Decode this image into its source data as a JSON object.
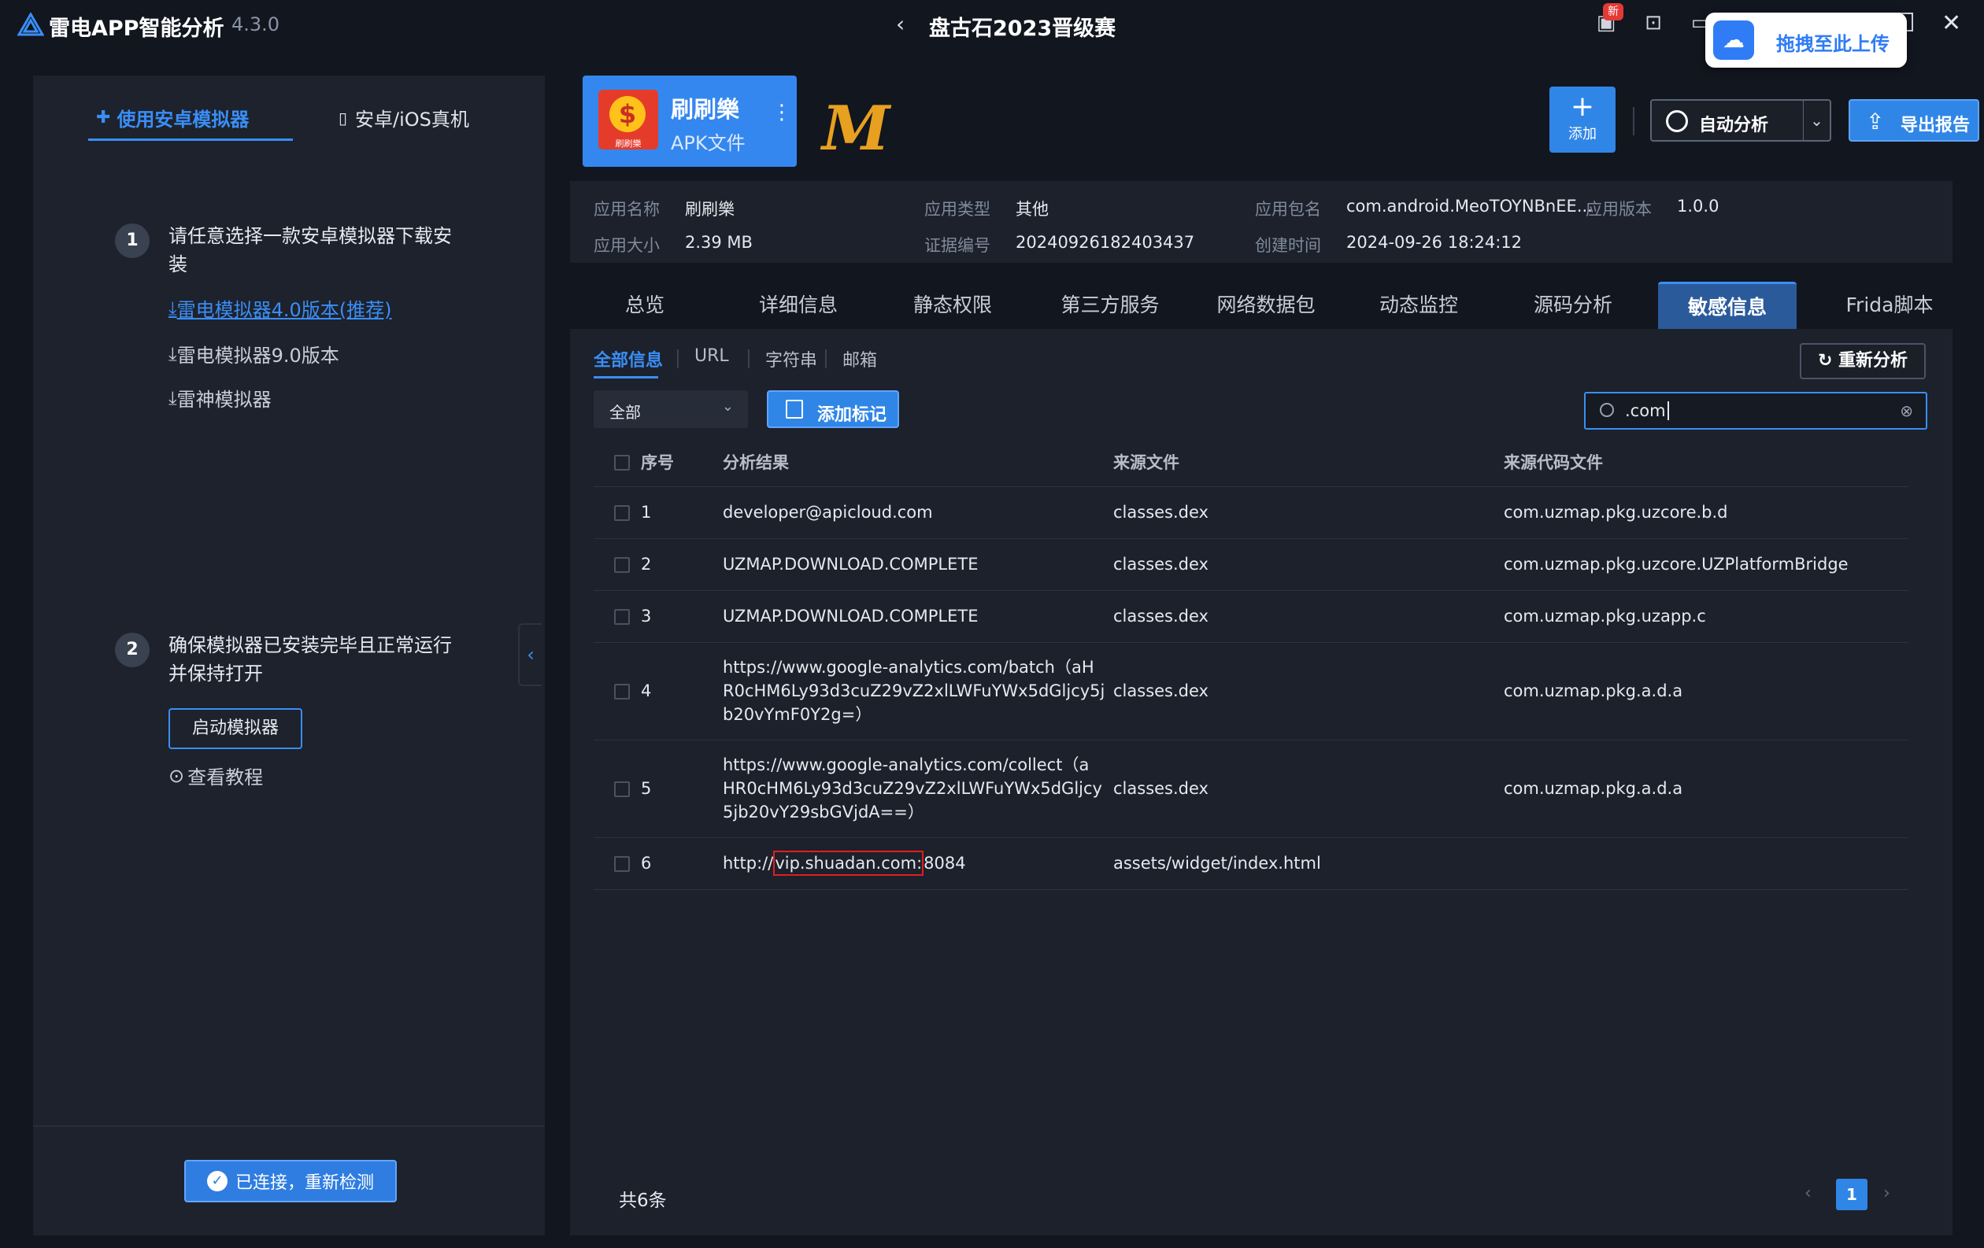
{
  "titlebar": {
    "app_name": "雷电APP智能分析",
    "version": "4.3.0",
    "center_title": "盘古石2023晋级赛",
    "badge_new": "新",
    "upload_label": "拖拽至此上传"
  },
  "left": {
    "tab_emulator": "使用安卓模拟器",
    "tab_device": "安卓/iOS真机",
    "step1_num": "1",
    "step1_text": "请任意选择一款安卓模拟器下载安装",
    "links": [
      "雷电模拟器4.0版本(推荐)",
      "雷电模拟器9.0版本",
      "雷神模拟器"
    ],
    "step2_num": "2",
    "step2_text": "确保模拟器已安装完毕且正常运行并保持打开",
    "start_btn": "启动模拟器",
    "tutorial": "查看教程",
    "connected_btn": "已连接，重新检测"
  },
  "app": {
    "logo_label": "刷刷樂",
    "name": "刷刷樂",
    "type": "APK文件",
    "mark": "M",
    "add_label": "添加",
    "auto_label": "自动分析",
    "export_label": "导出报告"
  },
  "info": {
    "name_k": "应用名称",
    "name_v": "刷刷樂",
    "apptype_k": "应用类型",
    "apptype_v": "其他",
    "pkg_k": "应用包名",
    "pkg_v": "com.android.MeoTOYNBnEE...",
    "ver_k": "应用版本",
    "ver_v": "1.0.0",
    "size_k": "应用大小",
    "size_v": "2.39 MB",
    "cert_k": "证据编号",
    "cert_v": "20240926182403437",
    "created_k": "创建时间",
    "created_v": "2024-09-26 18:24:12"
  },
  "tabs": [
    "总览",
    "详细信息",
    "静态权限",
    "第三方服务",
    "网络数据包",
    "动态监控",
    "源码分析",
    "敏感信息",
    "Frida脚本"
  ],
  "subtabs": [
    "全部信息",
    "URL",
    "字符串",
    "邮箱"
  ],
  "filter": {
    "select_value": "全部",
    "mark_label": "添加标记",
    "search_value": ".com",
    "reanalyze": "重新分析"
  },
  "table": {
    "headers": [
      "序号",
      "分析结果",
      "来源文件",
      "来源代码文件"
    ],
    "rows": [
      {
        "no": "1",
        "result": "developer@apicloud.com",
        "file": "classes.dex",
        "code": "com.uzmap.pkg.uzcore.b.d"
      },
      {
        "no": "2",
        "result": "UZMAP.DOWNLOAD.COMPLETE",
        "file": "classes.dex",
        "code": "com.uzmap.pkg.uzcore.UZPlatformBridge"
      },
      {
        "no": "3",
        "result": "UZMAP.DOWNLOAD.COMPLETE",
        "file": "classes.dex",
        "code": "com.uzmap.pkg.uzapp.c"
      },
      {
        "no": "4",
        "result_l1": "https://www.google-analytics.com/batch（aH",
        "result_l2": "R0cHM6Ly93d3cuZ29vZ2xlLWFuYWx5dGljcy5j",
        "result_l3": "b20vYmF0Y2g=）",
        "file": "classes.dex",
        "code": "com.uzmap.pkg.a.d.a"
      },
      {
        "no": "5",
        "result_l1": "https://www.google-analytics.com/collect（a",
        "result_l2": "HR0cHM6Ly93d3cuZ29vZ2xlLWFuYWx5dGljcy",
        "result_l3": "5jb20vY29sbGVjdA==）",
        "file": "classes.dex",
        "code": "com.uzmap.pkg.a.d.a"
      },
      {
        "no": "6",
        "result_pre": "http://",
        "result_hl": "vip.shuadan.com:",
        "result_post": "8084",
        "file": "assets/widget/index.html",
        "code": ""
      }
    ]
  },
  "footer": {
    "total": "共6条",
    "page": "1"
  }
}
